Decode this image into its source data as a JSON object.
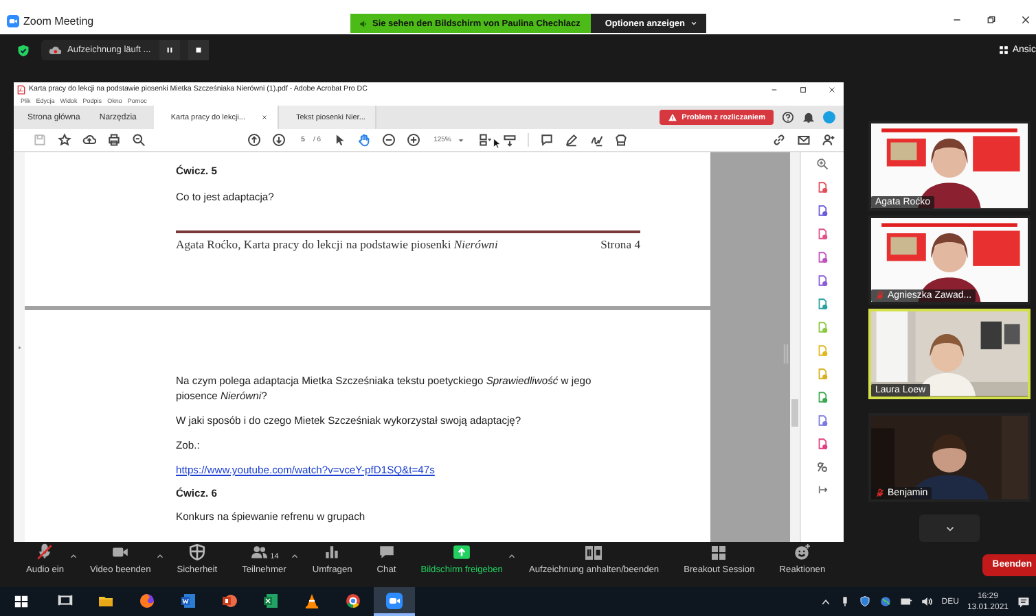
{
  "window": {
    "title": "Zoom Meeting"
  },
  "share_banner": {
    "text": "Sie sehen den Bildschirm von Paulina Chechlacz",
    "options_button": "Optionen anzeigen"
  },
  "recording": {
    "label": "Aufzeichnung läuft ..."
  },
  "view_button": "Ansic",
  "acrobat": {
    "title": "Karta pracy do lekcji na podstawie piosenki Mietka Szcześniaka Nierówni (1).pdf - Adobe Acrobat Pro DC",
    "menu": [
      "Plik",
      "Edycja",
      "Widok",
      "Podpis",
      "Okno",
      "Pomoc"
    ],
    "nav_tabs": [
      {
        "label": "Strona główna"
      },
      {
        "label": "Narzędzia"
      }
    ],
    "doc_tabs": [
      {
        "label": "Karta pracy do lekcji...",
        "selected": true
      },
      {
        "label": "Tekst piosenki Nier...",
        "selected": false
      }
    ],
    "alert_button": "Problem z rozliczaniem",
    "page_number": "5",
    "page_count": "/ 6",
    "zoom": "125%",
    "pages": [
      {
        "blocks": [
          {
            "kind": "heading",
            "text": "Ćwicz. 5"
          },
          {
            "kind": "paragraph",
            "text": "Co to jest adaptacja?"
          },
          {
            "kind": "footer",
            "text": "Agata Roćko, Karta pracy do lekcji na podstawie piosenki *Nierówni*",
            "page_label": "Strona 4"
          }
        ]
      },
      {
        "blocks": [
          {
            "kind": "paragraph",
            "text": "Na czym polega adaptacja Mietka Szcześniaka tekstu poetyckiego *Sprawiedliwość* w jego piosence *Nierówni*?"
          },
          {
            "kind": "paragraph",
            "text": "W jaki sposób i do czego Mietek Szcześniak wykorzystał swoją adaptację?"
          },
          {
            "kind": "paragraph",
            "text": "Zob.:"
          },
          {
            "kind": "link",
            "text": "https://www.youtube.com/watch?v=vceY-pfD1SQ&t=47s"
          },
          {
            "kind": "heading",
            "text": "Ćwicz. 6"
          },
          {
            "kind": "paragraph",
            "text": "Konkurs na śpiewanie refrenu w grupach"
          }
        ]
      }
    ]
  },
  "participants": [
    {
      "name": "Agata Roćko",
      "muted": false,
      "speaking": false,
      "kind": "slide"
    },
    {
      "name": "Agnieszka Zawad...",
      "muted": true,
      "speaking": false,
      "kind": "slide"
    },
    {
      "name": "Laura Loew",
      "muted": false,
      "speaking": true,
      "kind": "room"
    },
    {
      "name": "Benjamin",
      "muted": true,
      "speaking": false,
      "kind": "dark"
    }
  ],
  "toolbar": [
    {
      "kind": "audio",
      "label": "Audio ein",
      "muted": true,
      "caret": true
    },
    {
      "kind": "video",
      "label": "Video beenden",
      "caret": true
    },
    {
      "kind": "security",
      "label": "Sicherheit",
      "caret": false
    },
    {
      "kind": "participants",
      "label": "Teilnehmer",
      "count": "14",
      "caret": true
    },
    {
      "kind": "polls",
      "label": "Umfragen",
      "caret": false
    },
    {
      "kind": "chat",
      "label": "Chat",
      "caret": false
    },
    {
      "kind": "share",
      "label": "Bildschirm freigeben",
      "caret": true
    },
    {
      "kind": "record",
      "label": "Aufzeichnung anhalten/beenden",
      "caret": false
    },
    {
      "kind": "breakout",
      "label": "Breakout Session",
      "caret": false
    },
    {
      "kind": "reactions",
      "label": "Reaktionen",
      "caret": false
    }
  ],
  "end_button": "Beenden",
  "taskbar": {
    "apps": [
      {
        "kind": "taskview",
        "active": false
      },
      {
        "kind": "folder",
        "active": false
      },
      {
        "kind": "firefox",
        "active": false
      },
      {
        "kind": "word",
        "active": false
      },
      {
        "kind": "powerpoint",
        "active": false
      },
      {
        "kind": "excel",
        "active": false
      },
      {
        "kind": "vlc",
        "active": false
      },
      {
        "kind": "chrome",
        "active": false
      },
      {
        "kind": "zoom",
        "active": true
      }
    ],
    "language": "DEU",
    "time": "16:29",
    "date": "13.01.2021"
  }
}
